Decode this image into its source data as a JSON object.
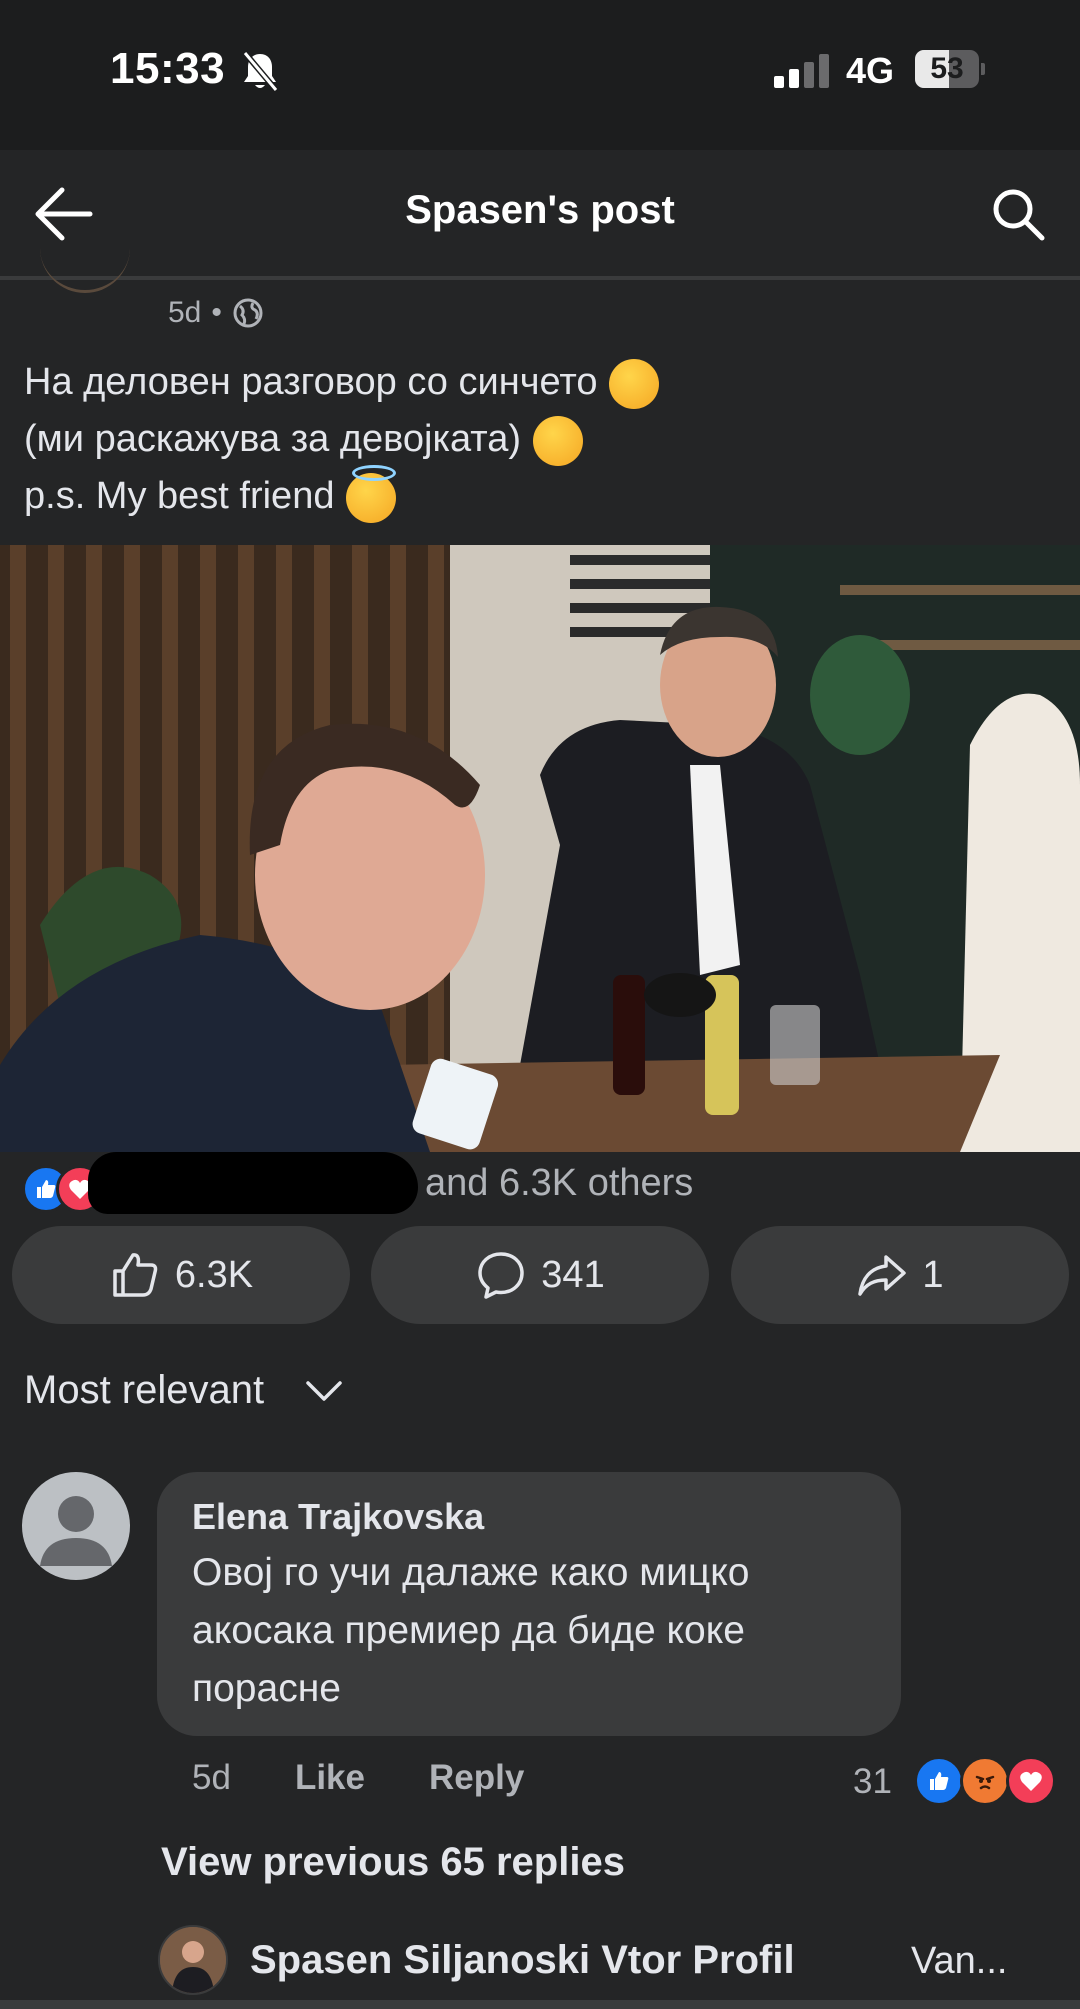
{
  "status_bar": {
    "time": "15:33",
    "network": "4G",
    "battery": "53",
    "battery_level": 0.53
  },
  "header": {
    "title": "Spasen's post"
  },
  "post": {
    "meta": "5d",
    "text_lines": [
      "На деловен разговор со синчето",
      "(ми раскажува за девојката)",
      "p.s. My best friend"
    ],
    "reactions_summary": "and 6.3K others"
  },
  "actions": {
    "like_count": "6.3K",
    "comment_count": "341",
    "share_count": "1"
  },
  "sort": {
    "label": "Most relevant"
  },
  "comment": {
    "author": "Elena Trajkovska",
    "text": "Овој го учи далаже како мицко акосака премиер да биде коке порасне",
    "time": "5d",
    "like_label": "Like",
    "reply_label": "Reply",
    "reaction_count": "31"
  },
  "replies": {
    "view_previous": "View previous 65 replies",
    "reply_author": "Spasen Siljanoski Vtor Profil",
    "reply_snippet": "Van..."
  },
  "colors": {
    "like_blue": "#1877f2",
    "love_red": "#f33e58",
    "angry_orange": "#f07a33",
    "background": "#242526"
  }
}
